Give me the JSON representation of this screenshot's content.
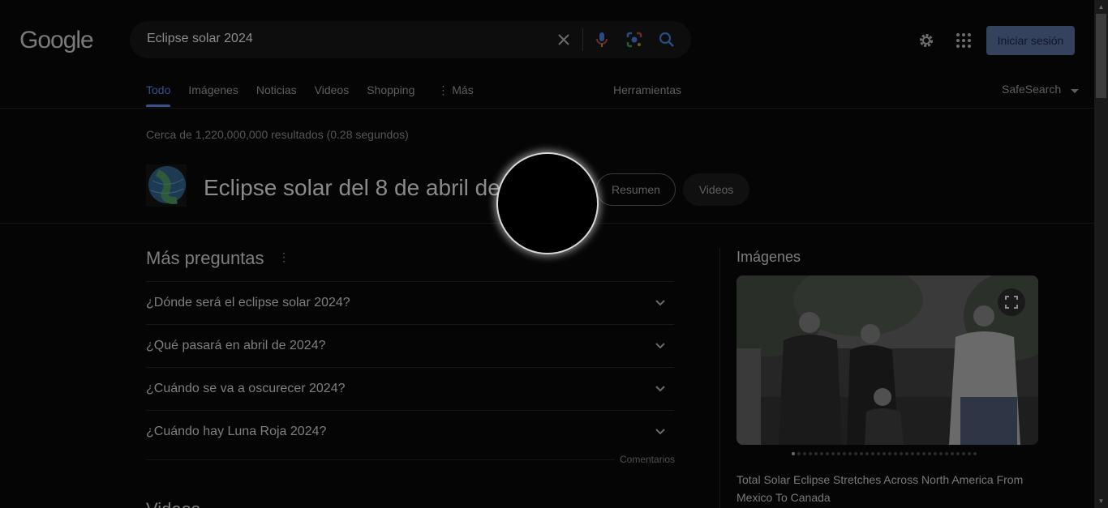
{
  "header": {
    "logo": "Google",
    "search_value": "Eclipse solar 2024",
    "signin_label": "Iniciar sesión",
    "icons": [
      "clear-icon",
      "microphone-icon",
      "lens-icon",
      "search-icon",
      "gear-icon",
      "apps-grid-icon"
    ]
  },
  "tabs": {
    "items": [
      "Todo",
      "Imágenes",
      "Noticias",
      "Videos",
      "Shopping",
      "⋮ Más"
    ],
    "active": "Todo",
    "tools_label": "Herramientas",
    "safesearch_label": "SafeSearch"
  },
  "stats": "Cerca de 1,220,000,000 resultados (0.28 segundos)",
  "entity": {
    "title": "Eclipse solar del 8 de abril de 2024",
    "kebab": "⋮",
    "chips": [
      "Resumen",
      "Videos"
    ]
  },
  "questions": {
    "title": "Más preguntas",
    "items": [
      "¿Dónde será el eclipse solar 2024?",
      "¿Qué pasará en abril de 2024?",
      "¿Cuándo se va a oscurecer 2024?",
      "¿Cuándo hay Luna Roja 2024?"
    ],
    "comments_label": "Comentarios"
  },
  "videos_title": "Videos",
  "images": {
    "title": "Imágenes",
    "caption": "Total Solar Eclipse Stretches Across North America From Mexico To Canada"
  },
  "colors": {
    "accent": "#33528a",
    "signin_bg": "#34425e",
    "background": "#050505"
  }
}
